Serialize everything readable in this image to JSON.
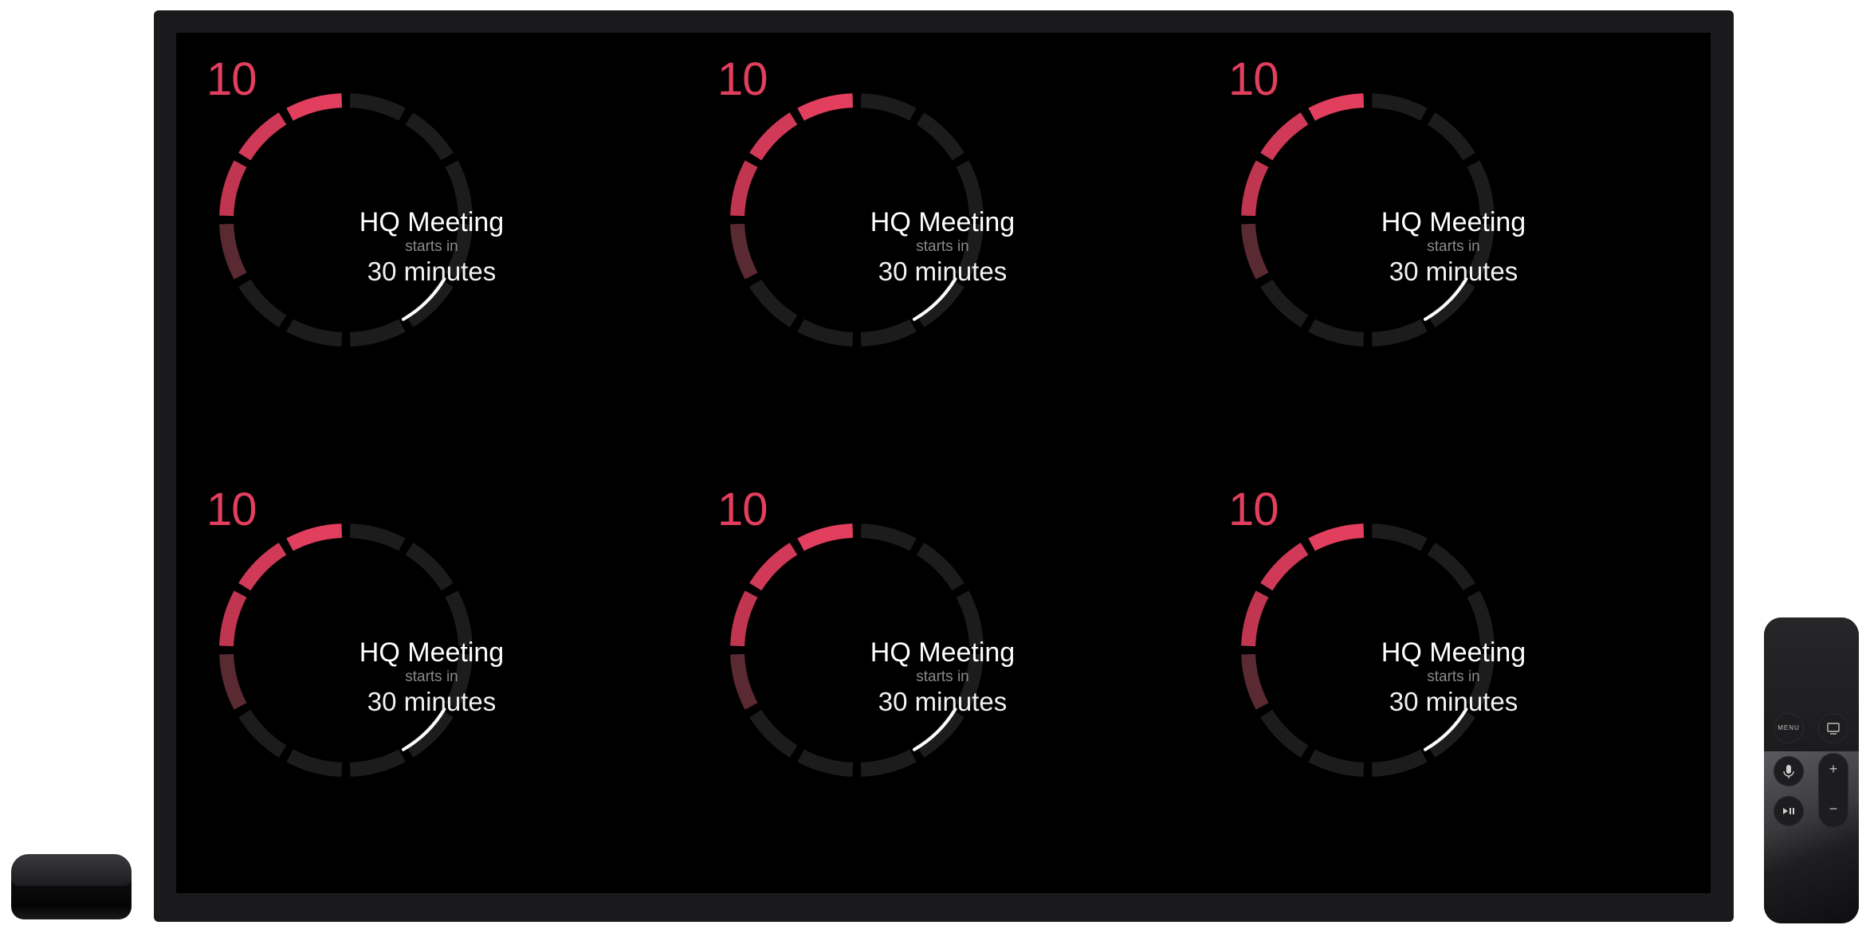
{
  "colors": {
    "accent": "#e23e5e",
    "accent_dim": "#5a2a32",
    "track": "#1c1c1c",
    "indicator": "#ffffff"
  },
  "tiles": [
    {
      "count": "10",
      "title": "HQ Meeting",
      "subtitle": "starts in",
      "time": "30 minutes"
    },
    {
      "count": "10",
      "title": "HQ Meeting",
      "subtitle": "starts in",
      "time": "30 minutes"
    },
    {
      "count": "10",
      "title": "HQ Meeting",
      "subtitle": "starts in",
      "time": "30 minutes"
    },
    {
      "count": "10",
      "title": "HQ Meeting",
      "subtitle": "starts in",
      "time": "30 minutes"
    },
    {
      "count": "10",
      "title": "HQ Meeting",
      "subtitle": "starts in",
      "time": "30 minutes"
    },
    {
      "count": "10",
      "title": "HQ Meeting",
      "subtitle": "starts in",
      "time": "30 minutes"
    }
  ],
  "remote": {
    "menu_label": "MENU",
    "tv_icon": "tv-icon",
    "mic_icon": "microphone-icon",
    "play_pause_icon": "play-pause-icon",
    "volume_up": "+",
    "volume_down": "−"
  }
}
